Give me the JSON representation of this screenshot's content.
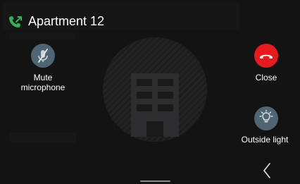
{
  "header": {
    "title": "Apartment 12",
    "call_icon": "phone-connected-icon",
    "call_icon_color": "#2fb35a"
  },
  "video": {
    "placeholder_icon": "building-icon"
  },
  "controls": {
    "mute": {
      "label": "Mute\nmicrophone",
      "icon": "microphone-muted-icon",
      "color": "#4f6672"
    },
    "close": {
      "label": "Close",
      "icon": "hang-up-icon",
      "color": "#e8191f"
    },
    "outside_light": {
      "label": "Outside light",
      "icon": "light-bulb-icon",
      "color": "#4f6672"
    }
  },
  "navigation": {
    "back_icon": "chevron-left-icon"
  }
}
